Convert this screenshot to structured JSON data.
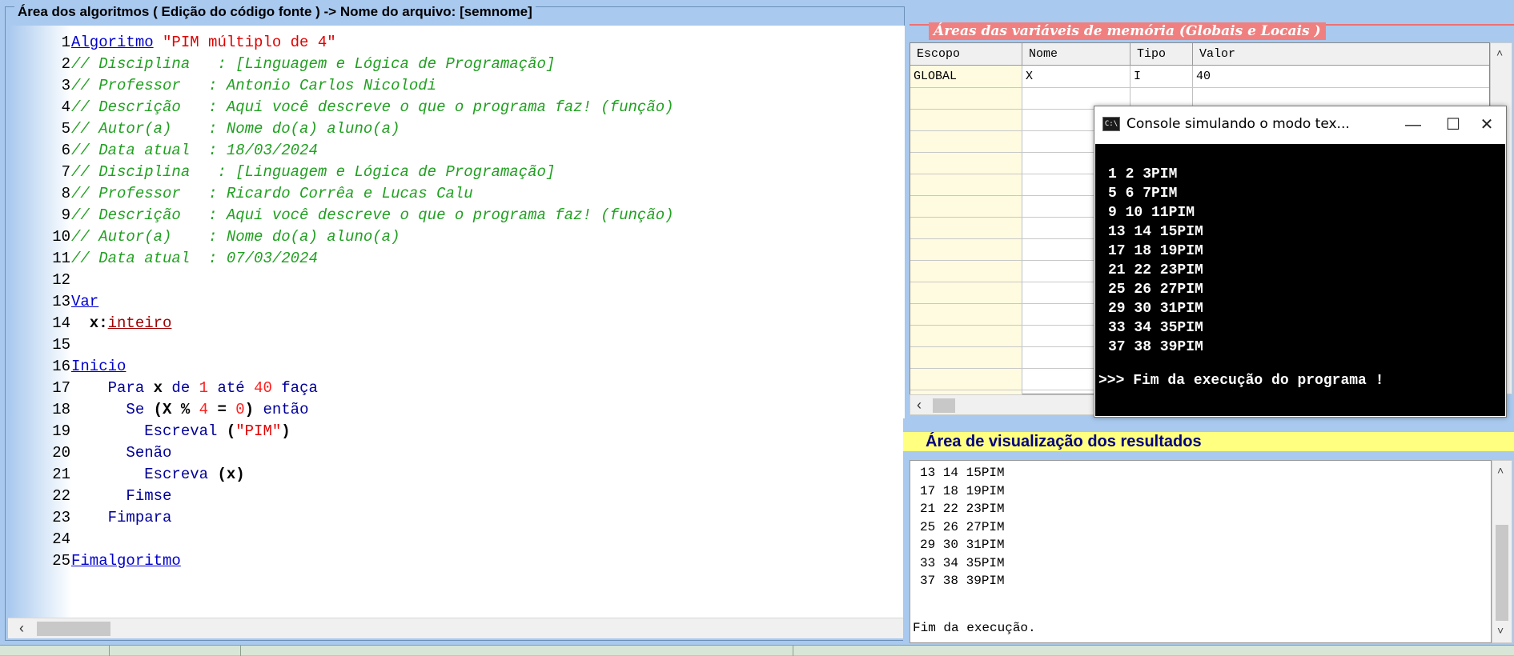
{
  "editor": {
    "title": "Área dos algoritmos ( Edição do código fonte ) -> Nome do arquivo: [semnome]",
    "lines": [
      {
        "n": "1",
        "parts": [
          {
            "t": "Algoritmo",
            "c": "kw"
          },
          {
            "t": " ",
            "c": "plain"
          },
          {
            "t": "\"PIM múltiplo de 4\"",
            "c": "str"
          }
        ]
      },
      {
        "n": "2",
        "parts": [
          {
            "t": "// Disciplina   : [Linguagem e Lógica de Programação]",
            "c": "cmt"
          }
        ]
      },
      {
        "n": "3",
        "parts": [
          {
            "t": "// Professor   : Antonio Carlos Nicolodi",
            "c": "cmt"
          }
        ]
      },
      {
        "n": "4",
        "parts": [
          {
            "t": "// Descrição   : Aqui você descreve o que o programa faz! (função)",
            "c": "cmt"
          }
        ]
      },
      {
        "n": "5",
        "parts": [
          {
            "t": "// Autor(a)    : Nome do(a) aluno(a)",
            "c": "cmt"
          }
        ]
      },
      {
        "n": "6",
        "parts": [
          {
            "t": "// Data atual  : 18/03/2024",
            "c": "cmt"
          }
        ]
      },
      {
        "n": "7",
        "parts": [
          {
            "t": "// Disciplina   : [Linguagem e Lógica de Programação]",
            "c": "cmt"
          }
        ]
      },
      {
        "n": "8",
        "parts": [
          {
            "t": "// Professor   : Ricardo Corrêa e Lucas Calu",
            "c": "cmt"
          }
        ]
      },
      {
        "n": "9",
        "parts": [
          {
            "t": "// Descrição   : Aqui você descreve o que o programa faz! (função)",
            "c": "cmt"
          }
        ]
      },
      {
        "n": "10",
        "parts": [
          {
            "t": "// Autor(a)    : Nome do(a) aluno(a)",
            "c": "cmt"
          }
        ]
      },
      {
        "n": "11",
        "parts": [
          {
            "t": "// Data atual  : 07/03/2024",
            "c": "cmt"
          }
        ]
      },
      {
        "n": "12",
        "parts": []
      },
      {
        "n": "13",
        "parts": [
          {
            "t": "Var",
            "c": "kw"
          }
        ]
      },
      {
        "n": "14",
        "parts": [
          {
            "t": "  x:",
            "c": "bold"
          },
          {
            "t": "inteiro",
            "c": "type"
          }
        ]
      },
      {
        "n": "15",
        "parts": []
      },
      {
        "n": "16",
        "parts": [
          {
            "t": "Inicio",
            "c": "kw"
          }
        ]
      },
      {
        "n": "17",
        "parts": [
          {
            "t": "    Para ",
            "c": "kw2"
          },
          {
            "t": "x",
            "c": "bold"
          },
          {
            "t": " de ",
            "c": "kw2"
          },
          {
            "t": "1",
            "c": "num"
          },
          {
            "t": " até ",
            "c": "kw2"
          },
          {
            "t": "40",
            "c": "num"
          },
          {
            "t": " faça",
            "c": "kw2"
          }
        ]
      },
      {
        "n": "18",
        "parts": [
          {
            "t": "      Se ",
            "c": "kw2"
          },
          {
            "t": "(X % ",
            "c": "bold"
          },
          {
            "t": "4",
            "c": "num"
          },
          {
            "t": " = ",
            "c": "bold"
          },
          {
            "t": "0",
            "c": "num"
          },
          {
            "t": ")",
            "c": "bold"
          },
          {
            "t": " então",
            "c": "kw2"
          }
        ]
      },
      {
        "n": "19",
        "parts": [
          {
            "t": "        Escreval ",
            "c": "kw2"
          },
          {
            "t": "(",
            "c": "bold"
          },
          {
            "t": "\"PIM\"",
            "c": "str"
          },
          {
            "t": ")",
            "c": "bold"
          }
        ]
      },
      {
        "n": "20",
        "parts": [
          {
            "t": "      Senão",
            "c": "kw2"
          }
        ]
      },
      {
        "n": "21",
        "parts": [
          {
            "t": "        Escreva ",
            "c": "kw2"
          },
          {
            "t": "(x)",
            "c": "bold"
          }
        ]
      },
      {
        "n": "22",
        "parts": [
          {
            "t": "      Fimse",
            "c": "kw2"
          }
        ]
      },
      {
        "n": "23",
        "parts": [
          {
            "t": "    Fimpara",
            "c": "kw2"
          }
        ]
      },
      {
        "n": "24",
        "parts": []
      },
      {
        "n": "25",
        "parts": [
          {
            "t": "Fimalgoritmo",
            "c": "kw"
          }
        ]
      }
    ]
  },
  "variables": {
    "title": "Áreas das variáveis de memória (Globais e Locais )",
    "columns": [
      "Escopo",
      "Nome",
      "Tipo",
      "Valor"
    ],
    "rows": [
      {
        "escopo": "GLOBAL",
        "nome": "X",
        "tipo": "I",
        "valor": "40"
      }
    ]
  },
  "console": {
    "title": "Console simulando o modo tex...",
    "icon_label": "C:\\",
    "minimize": "—",
    "maximize": "☐",
    "close": "✕",
    "lines": [
      "1 2 3PIM",
      "5 6 7PIM",
      "9 10 11PIM",
      "13 14 15PIM",
      "17 18 19PIM",
      "21 22 23PIM",
      "25 26 27PIM",
      "29 30 31PIM",
      "33 34 35PIM",
      "37 38 39PIM"
    ],
    "end_message": ">>> Fim da execução do programa !"
  },
  "results": {
    "title": "Área de visualização dos resultados",
    "lines": [
      "13 14 15PIM",
      "17 18 19PIM",
      "21 22 23PIM",
      "25 26 27PIM",
      "29 30 31PIM",
      "33 34 35PIM",
      "37 38 39PIM"
    ],
    "end_message": "Fim da execução."
  },
  "icons": {
    "scroll_left": "‹",
    "scroll_up": "˄",
    "scroll_down": "˅"
  },
  "colors": {
    "panel_bg": "#a9c9ee",
    "comment": "#20a020",
    "keyword": "#0000cc",
    "string": "#e00000",
    "vars_title_bg": "#f08080",
    "results_title_bg": "#ffff80"
  }
}
